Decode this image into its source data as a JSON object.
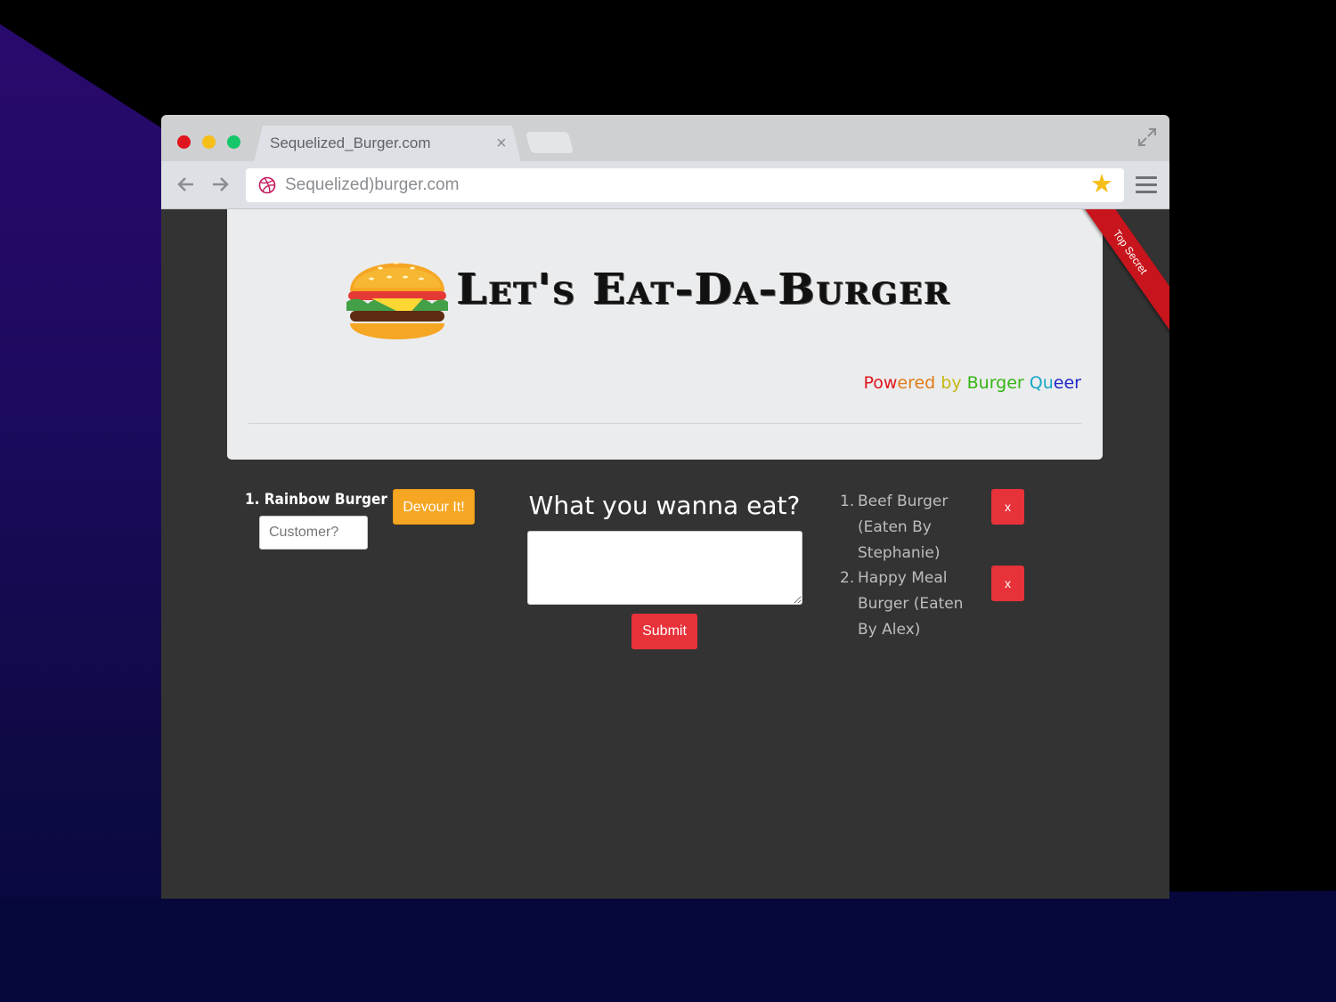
{
  "browser": {
    "tab_title": "Sequelized_Burger.com",
    "tab_close": "×",
    "url": "Sequelized)burger.com",
    "star": "★"
  },
  "header": {
    "title": "Let's Eat-Da-Burger",
    "powered": {
      "p1": "Pow",
      "p2": "ered",
      "p3": " by ",
      "p4": "Burger",
      "p5": " Qu",
      "p6": "eer"
    },
    "ribbon": "Top Secret"
  },
  "burgers_to_eat": [
    {
      "number": "1.",
      "name": "Rainbow Burger",
      "customer_placeholder": "Customer?",
      "devour_label": "Devour It!"
    }
  ],
  "form": {
    "title": "What you wanna eat?",
    "submit_label": "Submit"
  },
  "eaten_burgers": [
    {
      "number": "1.",
      "text": "Beef Burger (Eaten By Stephanie)",
      "delete_label": "x"
    },
    {
      "number": "2.",
      "text": "Happy Meal Burger (Eaten By Alex)",
      "delete_label": "x"
    }
  ],
  "colors": {
    "devour": "#f5a623",
    "submit": "#e8323a",
    "delete": "#e8323a",
    "page_bg": "#333333"
  }
}
